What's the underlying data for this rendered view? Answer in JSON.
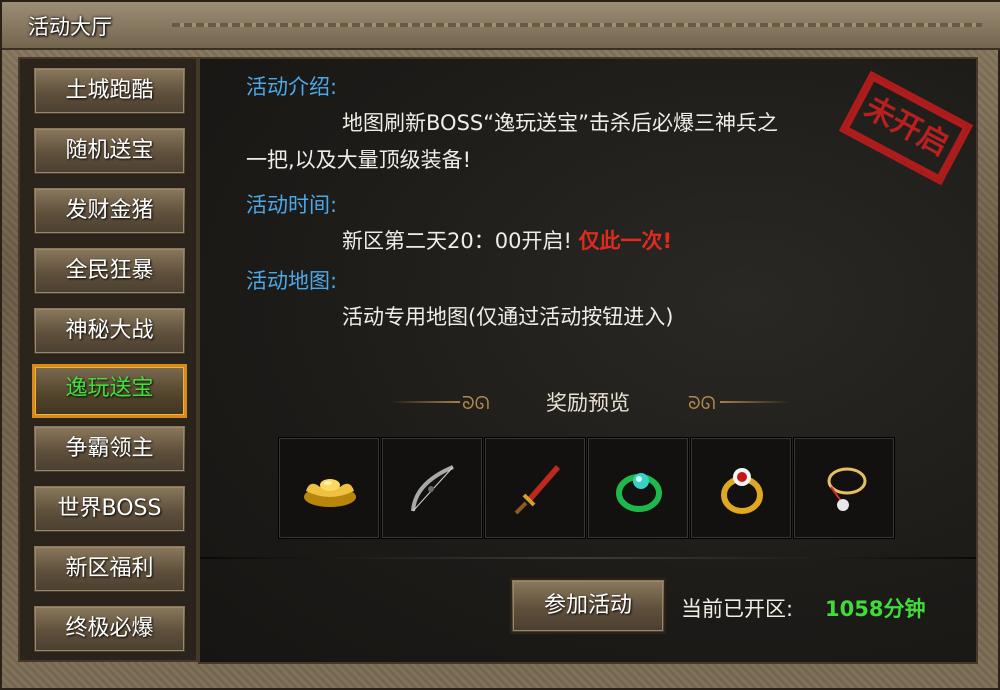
{
  "window": {
    "title": "活动大厅"
  },
  "sidebar": {
    "items": [
      {
        "label": "土城跑酷",
        "active": false
      },
      {
        "label": "随机送宝",
        "active": false
      },
      {
        "label": "发财金猪",
        "active": false
      },
      {
        "label": "全民狂暴",
        "active": false
      },
      {
        "label": "神秘大战",
        "active": false
      },
      {
        "label": "逸玩送宝",
        "active": true
      },
      {
        "label": "争霸领主",
        "active": false
      },
      {
        "label": "世界BOSS",
        "active": false
      },
      {
        "label": "新区福利",
        "active": false
      },
      {
        "label": "终极必爆",
        "active": false
      }
    ]
  },
  "activity": {
    "intro_title": "活动介绍:",
    "intro_line1": "地图刷新BOSS“逸玩送宝”击杀后必爆三神兵之",
    "intro_line2": "一把,以及大量顶级装备!",
    "time_title": "活动时间:",
    "time_text": "新区第二天20：00开启!",
    "time_highlight": "仅此一次!",
    "map_title": "活动地图:",
    "map_text": "活动专用地图(仅通过活动按钮进入)",
    "stamp": "未开启"
  },
  "rewards": {
    "heading": "奖励预览",
    "items": [
      {
        "icon": "gold-ingot-icon"
      },
      {
        "icon": "bow-icon"
      },
      {
        "icon": "sword-icon"
      },
      {
        "icon": "jade-ring-icon"
      },
      {
        "icon": "ruby-ring-icon"
      },
      {
        "icon": "necklace-icon"
      }
    ]
  },
  "footer": {
    "join_label": "参加活动",
    "open_label": "当前已开区:",
    "open_value": "1058分钟"
  },
  "colors": {
    "section_title": "#4da8e8",
    "highlight_red": "#e02a1f",
    "active_menu": "#3fe03a",
    "open_value": "#3fdc3a"
  }
}
